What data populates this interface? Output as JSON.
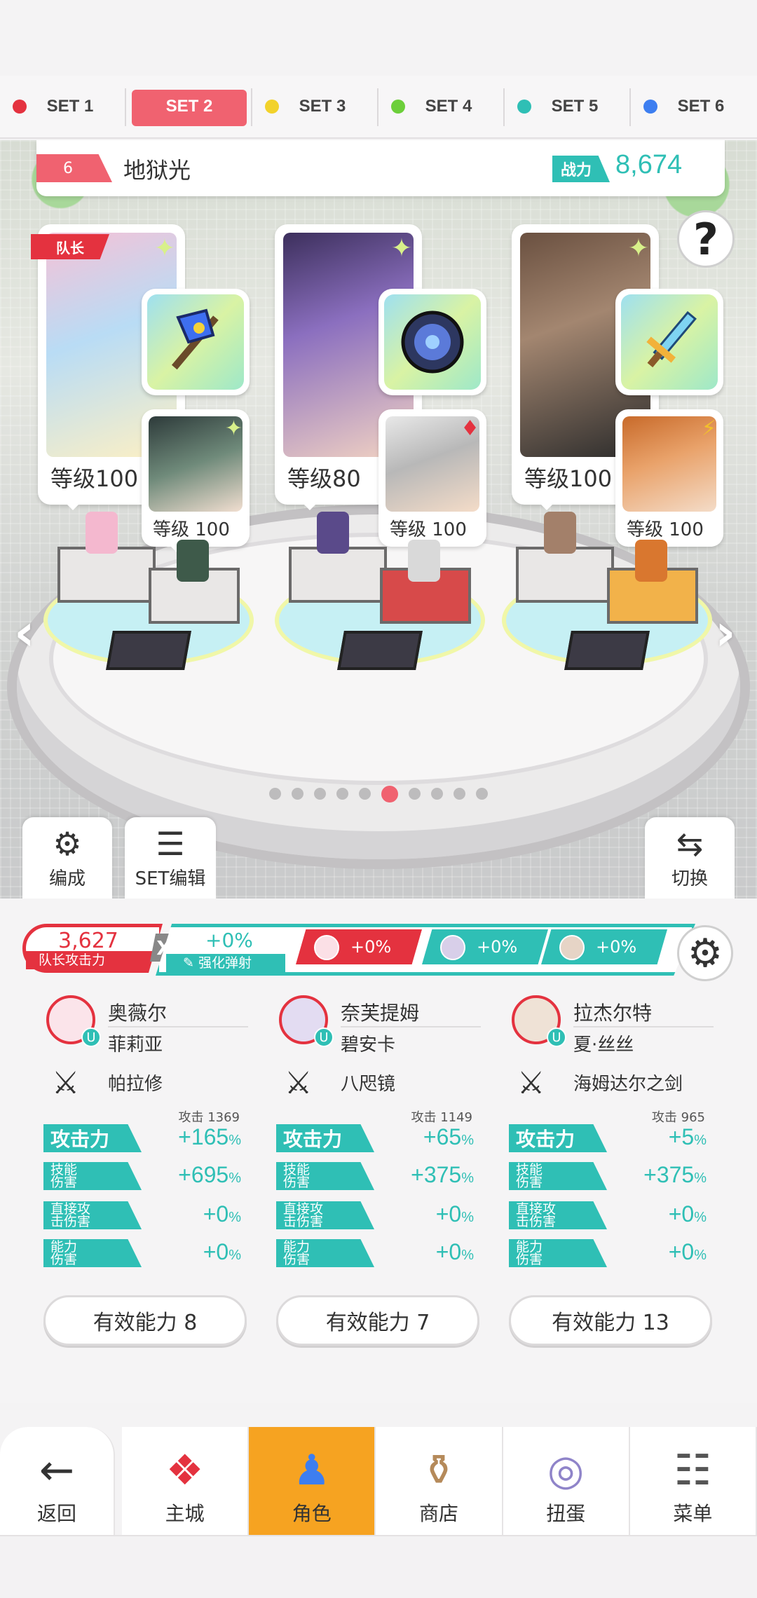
{
  "set_tabs": [
    {
      "label": "SET 1",
      "color": "#e4323f"
    },
    {
      "label": "SET 2",
      "color": "#f06270"
    },
    {
      "label": "SET 3",
      "color": "#f2d22b"
    },
    {
      "label": "SET 4",
      "color": "#6ccf3a"
    },
    {
      "label": "SET 5",
      "color": "#2fbfb5"
    },
    {
      "label": "SET 6",
      "color": "#3d7ef0"
    }
  ],
  "active_set": "SET 2",
  "team": {
    "number": "6",
    "name": "地狱光",
    "power_label": "战力",
    "power_value": "8,674"
  },
  "help_icon": "?",
  "leader_badge": "队长",
  "characters": [
    {
      "level": "等级100",
      "sub_level": "等级 100",
      "sub_mark": "✦"
    },
    {
      "level": "等级80",
      "sub_level": "等级 100",
      "sub_mark": "♦"
    },
    {
      "level": "等级100",
      "sub_level": "等级 100",
      "sub_mark": "⚡"
    }
  ],
  "page_dots": {
    "count": 10,
    "active_index": 5
  },
  "stage_buttons": {
    "formation": "编成",
    "set_edit": "SET编辑",
    "switch": "切换"
  },
  "bonus": {
    "leader_atk_value": "3,627",
    "leader_atk_label": "队长攻击力",
    "x": "X",
    "reflect_value": "+0%",
    "reflect_label": "强化弹射",
    "chips": [
      {
        "value": "+0%",
        "color": "#e4323f"
      },
      {
        "value": "+0%",
        "color": "#2fbfb5"
      },
      {
        "value": "+0%",
        "color": "#2fbfb5"
      }
    ]
  },
  "columns": [
    {
      "name": "奥薇尔",
      "badge": "U",
      "sub_name": "菲莉亚",
      "weapon": "帕拉修",
      "atk_raw": "攻击 1369",
      "stats": [
        {
          "label": "攻击力",
          "value": "+165",
          "unit": "%"
        },
        {
          "label": "技能\n伤害",
          "value": "+695",
          "unit": "%"
        },
        {
          "label": "直接攻\n击伤害",
          "value": "+0",
          "unit": "%"
        },
        {
          "label": "能力\n伤害",
          "value": "+0",
          "unit": "%"
        }
      ],
      "effective": "有效能力 8"
    },
    {
      "name": "奈芙提姆",
      "badge": "U",
      "sub_name": "碧安卡",
      "weapon": "八咫镜",
      "atk_raw": "攻击 1149",
      "stats": [
        {
          "label": "攻击力",
          "value": "+65",
          "unit": "%"
        },
        {
          "label": "技能\n伤害",
          "value": "+375",
          "unit": "%"
        },
        {
          "label": "直接攻\n击伤害",
          "value": "+0",
          "unit": "%"
        },
        {
          "label": "能力\n伤害",
          "value": "+0",
          "unit": "%"
        }
      ],
      "effective": "有效能力 7"
    },
    {
      "name": "拉杰尔特",
      "badge": "U",
      "sub_name": "夏·丝丝",
      "weapon": "海姆达尔之剑",
      "atk_raw": "攻击 965",
      "stats": [
        {
          "label": "攻击力",
          "value": "+5",
          "unit": "%"
        },
        {
          "label": "技能\n伤害",
          "value": "+375",
          "unit": "%"
        },
        {
          "label": "直接攻\n击伤害",
          "value": "+0",
          "unit": "%"
        },
        {
          "label": "能力\n伤害",
          "value": "+0",
          "unit": "%"
        }
      ],
      "effective": "有效能力 13"
    }
  ],
  "nav": {
    "back": "返回",
    "castle": "主城",
    "character": "角色",
    "shop": "商店",
    "gacha": "扭蛋",
    "menu": "菜单"
  },
  "colors": {
    "teal": "#2fbfb5",
    "red": "#e4323f",
    "pink": "#f06270",
    "orange": "#f6a321"
  }
}
